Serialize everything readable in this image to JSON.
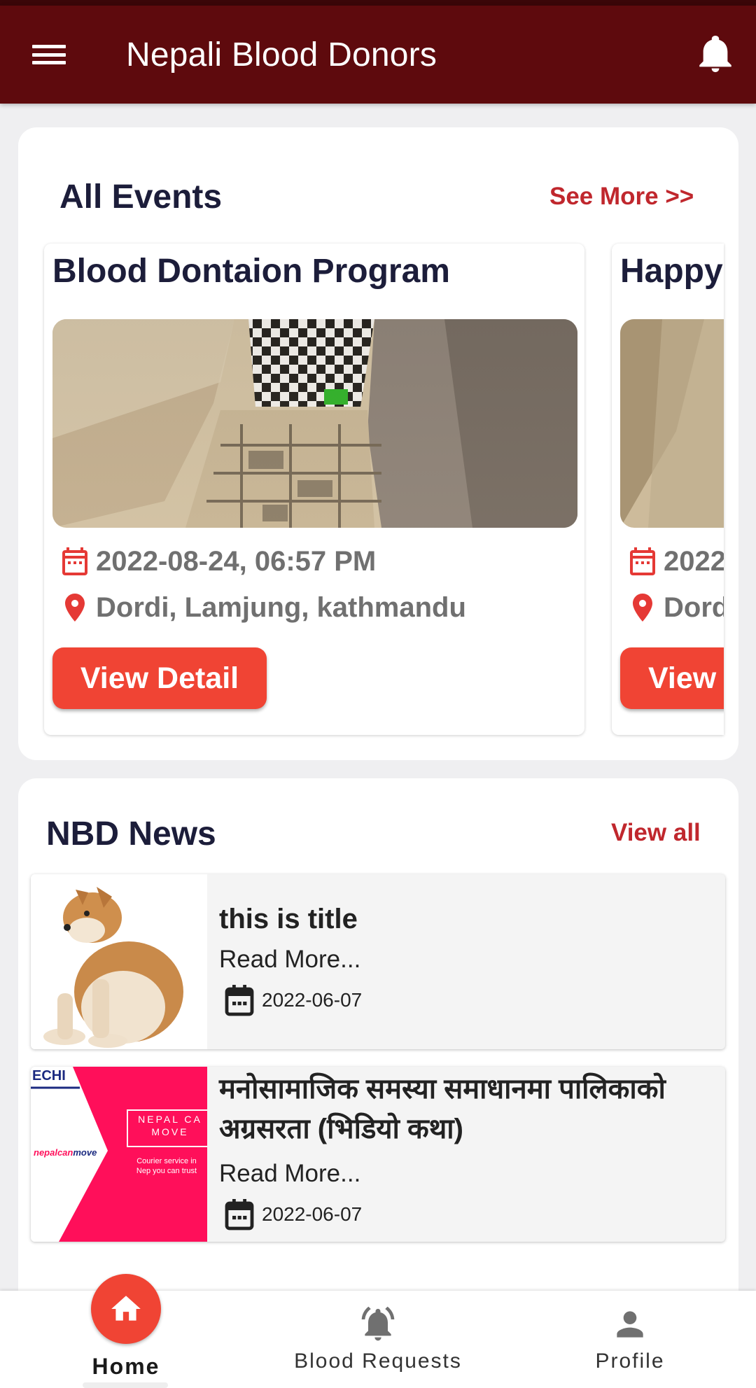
{
  "app": {
    "title": "Nepali Blood Donors"
  },
  "events": {
    "heading": "All Events",
    "see_more": "See More >>",
    "items": [
      {
        "title": "Blood Dontaion Program",
        "datetime": "2022-08-24, 06:57 PM",
        "location": "Dordi, Lamjung, kathmandu",
        "button": "View Detail"
      },
      {
        "title": "Happy",
        "datetime": "2022",
        "location": "Dordi",
        "button": "View"
      }
    ]
  },
  "news": {
    "heading": "NBD News",
    "view_all": "View all",
    "items": [
      {
        "title": "this is title",
        "read_more": "Read More...",
        "date": "2022-06-07"
      },
      {
        "title": "मनोसामाजिक समस्या समाधानमा पालिकाको अग्रसरता (भिडियो कथा)",
        "read_more": "Read More...",
        "date": "2022-06-07",
        "thumb_text": {
          "corner": "ECHI",
          "badge": "NEPAL CA MOVE",
          "brand_a": "nepalcan",
          "brand_b": "move",
          "tagline": "Courier service in Nep you can trust"
        }
      }
    ]
  },
  "bottom_nav": {
    "home": "Home",
    "blood_requests": "Blood Requests",
    "profile": "Profile"
  },
  "colors": {
    "appbar": "#5e0a0d",
    "accent": "#f04434",
    "link": "#c0272d",
    "heading": "#1c1d3a"
  }
}
